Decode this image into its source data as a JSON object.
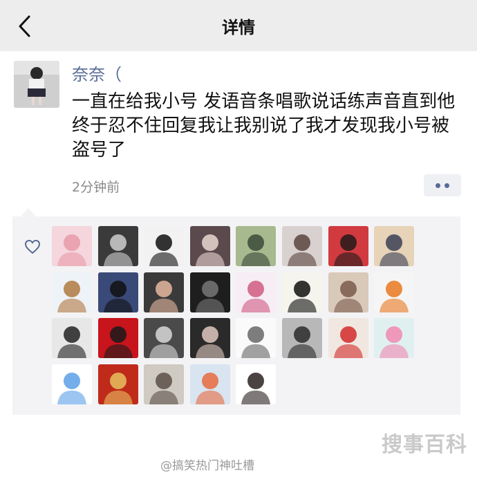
{
  "nav": {
    "title": "详情"
  },
  "post": {
    "author": "奈奈（",
    "text": "一直在给我小号 发语音条唱歌说话练声音直到他终于忍不住回复我让我别说了我才发现我小号被盗号了",
    "time": "2分钟前"
  },
  "likes": {
    "count": 29,
    "avatars": [
      {
        "icon": "anime-girl-pink-avatar",
        "bg": "#f4d6dc",
        "fg": "#e79aa8"
      },
      {
        "icon": "anime-girl-dark-avatar",
        "bg": "#3a3a3a",
        "fg": "#cfcfcf"
      },
      {
        "icon": "manga-girl-bw-avatar",
        "bg": "#f2f2f2",
        "fg": "#111111"
      },
      {
        "icon": "selfie-girl-avatar",
        "bg": "#5a4a4e",
        "fg": "#e9d6cf"
      },
      {
        "icon": "anime-boy-green-avatar",
        "bg": "#a7b98e",
        "fg": "#3a4a3a"
      },
      {
        "icon": "girl-portrait-avatar",
        "bg": "#d9d1cf",
        "fg": "#5a4540"
      },
      {
        "icon": "retro-anime-girl-avatar",
        "bg": "#d13a3f",
        "fg": "#241a1a"
      },
      {
        "icon": "illustrated-girl-avatar",
        "bg": "#e6d3b8",
        "fg": "#3a3f55"
      },
      {
        "icon": "peppa-bear-avatar",
        "bg": "#eef3f7",
        "fg": "#b07840"
      },
      {
        "icon": "boy-blue-avatar",
        "bg": "#3a4a78",
        "fg": "#111111"
      },
      {
        "icon": "pig-photo-avatar",
        "bg": "#3a3a3a",
        "fg": "#e6b8a0"
      },
      {
        "icon": "dark-hand-avatar",
        "bg": "#1e1e1e",
        "fg": "#777777"
      },
      {
        "icon": "chibi-girl-avatar",
        "bg": "#f6eef4",
        "fg": "#d05a80"
      },
      {
        "icon": "crayon-shinchan-avatar",
        "bg": "#f5f5ee",
        "fg": "#111111"
      },
      {
        "icon": "girl-room-photo-avatar",
        "bg": "#d9c9b9",
        "fg": "#7a5a4a"
      },
      {
        "icon": "pumpkin-avatar",
        "bg": "#f5f5f5",
        "fg": "#e87820"
      },
      {
        "icon": "girl-cat-hat-avatar",
        "bg": "#e7e7e7",
        "fg": "#222222"
      },
      {
        "icon": "red-luck-avatar",
        "bg": "#c8141c",
        "fg": "#1a1a1a"
      },
      {
        "icon": "manga-boy-avatar",
        "bg": "#4a4a4a",
        "fg": "#d8d8d8"
      },
      {
        "icon": "dark-hair-girl-avatar",
        "bg": "#2a2a2a",
        "fg": "#e0c8c0"
      },
      {
        "icon": "sketch-girl-avatar",
        "bg": "#fafafa",
        "fg": "#666666"
      },
      {
        "icon": "girl-mirror-avatar",
        "bg": "#b8b8b8",
        "fg": "#2a2a2a"
      },
      {
        "icon": "red-party-avatar",
        "bg": "#f0e8e0",
        "fg": "#d22a2a"
      },
      {
        "icon": "pink-hair-girl-avatar",
        "bg": "#e0f0f0",
        "fg": "#f089b0"
      },
      {
        "icon": "bird-face-avatar",
        "bg": "#ffffff",
        "fg": "#5aa0e8"
      },
      {
        "icon": "cat-photo-avatar",
        "bg": "#c02a1a",
        "fg": "#e8c060"
      },
      {
        "icon": "puppy-car-avatar",
        "bg": "#cfcac2",
        "fg": "#5a5048"
      },
      {
        "icon": "anime-girl-orange-avatar",
        "bg": "#d8e4f0",
        "fg": "#e86a40"
      },
      {
        "icon": "oreo-avatar",
        "bg": "#ffffff",
        "fg": "#2a2220"
      }
    ]
  },
  "watermark": {
    "text": "@搞笑热门神吐槽",
    "logo_text": "搜事百科"
  }
}
